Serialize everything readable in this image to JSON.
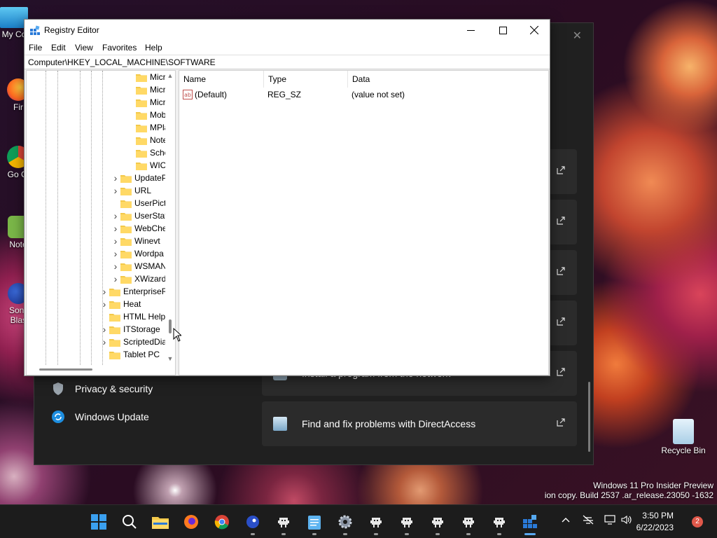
{
  "desktop": {
    "icons": [
      {
        "label": "My Co",
        "icon": "computer-icon"
      },
      {
        "label": "Fir",
        "icon": "firefox-icon"
      },
      {
        "label": "Go Chr",
        "icon": "chrome-icon"
      },
      {
        "label": "Note",
        "icon": "notepad-icon"
      },
      {
        "label": "Sonic Blast",
        "icon": "sonic-icon"
      },
      {
        "label": "Recycle Bin",
        "icon": "recycle-bin-icon"
      }
    ],
    "watermark": {
      "line1": "Windows 11 Pro Insider Preview",
      "line2": "ion copy. Build 2537 .ar_release.23050 -1632"
    }
  },
  "settings": {
    "nav": [
      {
        "label": "Privacy & security",
        "icon": "shield-icon"
      },
      {
        "label": "Windows Update",
        "icon": "windows-update-icon"
      }
    ],
    "cards": [
      {
        "label": ""
      },
      {
        "label": ""
      },
      {
        "label": ""
      },
      {
        "label": ""
      },
      {
        "label": "Install a program from the network"
      },
      {
        "label": "Find and fix problems with DirectAccess"
      }
    ]
  },
  "regedit": {
    "title": "Registry Editor",
    "menu": [
      "File",
      "Edit",
      "View",
      "Favorites",
      "Help"
    ],
    "address": "Computer\\HKEY_LOCAL_MACHINE\\SOFTWARE",
    "tree": [
      {
        "label": "Micro",
        "level": 3,
        "expandable": false
      },
      {
        "label": "Micro",
        "level": 3,
        "expandable": false
      },
      {
        "label": "Micro",
        "level": 3,
        "expandable": false
      },
      {
        "label": "Mobi",
        "level": 3,
        "expandable": false
      },
      {
        "label": "MPla",
        "level": 3,
        "expandable": false
      },
      {
        "label": "Note",
        "level": 3,
        "expandable": false
      },
      {
        "label": "Sche",
        "level": 3,
        "expandable": false
      },
      {
        "label": "WIC",
        "level": 3,
        "expandable": false
      },
      {
        "label": "UpdateP",
        "level": 2,
        "expandable": true
      },
      {
        "label": "URL",
        "level": 2,
        "expandable": true
      },
      {
        "label": "UserPict",
        "level": 2,
        "expandable": false
      },
      {
        "label": "UserStat",
        "level": 2,
        "expandable": true
      },
      {
        "label": "WebChe",
        "level": 2,
        "expandable": true
      },
      {
        "label": "Winevt",
        "level": 2,
        "expandable": true
      },
      {
        "label": "Wordpa",
        "level": 2,
        "expandable": true
      },
      {
        "label": "WSMAN",
        "level": 2,
        "expandable": true
      },
      {
        "label": "XWizard",
        "level": 2,
        "expandable": true
      },
      {
        "label": "EnterpriseR",
        "level": 1,
        "expandable": true
      },
      {
        "label": "Heat",
        "level": 1,
        "expandable": true
      },
      {
        "label": "HTML Help",
        "level": 1,
        "expandable": false
      },
      {
        "label": "ITStorage",
        "level": 1,
        "expandable": true
      },
      {
        "label": "ScriptedDia",
        "level": 1,
        "expandable": true
      },
      {
        "label": "Tablet PC",
        "level": 1,
        "expandable": false
      }
    ],
    "columns": [
      "Name",
      "Type",
      "Data"
    ],
    "values": [
      {
        "name": "(Default)",
        "type": "REG_SZ",
        "data": "(value not set)",
        "icon": "string-value-icon"
      }
    ]
  },
  "taskbar": {
    "apps": [
      "start-icon",
      "search-icon",
      "file-explorer-icon",
      "firefox-icon",
      "chrome-icon",
      "sonic-icon",
      "pixel-app-icon",
      "notepad-icon",
      "settings-gear-icon",
      "pixel-app-icon",
      "pixel-app-icon",
      "pixel-app-icon",
      "pixel-app-icon",
      "pixel-app-icon",
      "regedit-icon"
    ],
    "time": "3:50 PM",
    "date": "6/22/2023",
    "notifications": "2"
  }
}
